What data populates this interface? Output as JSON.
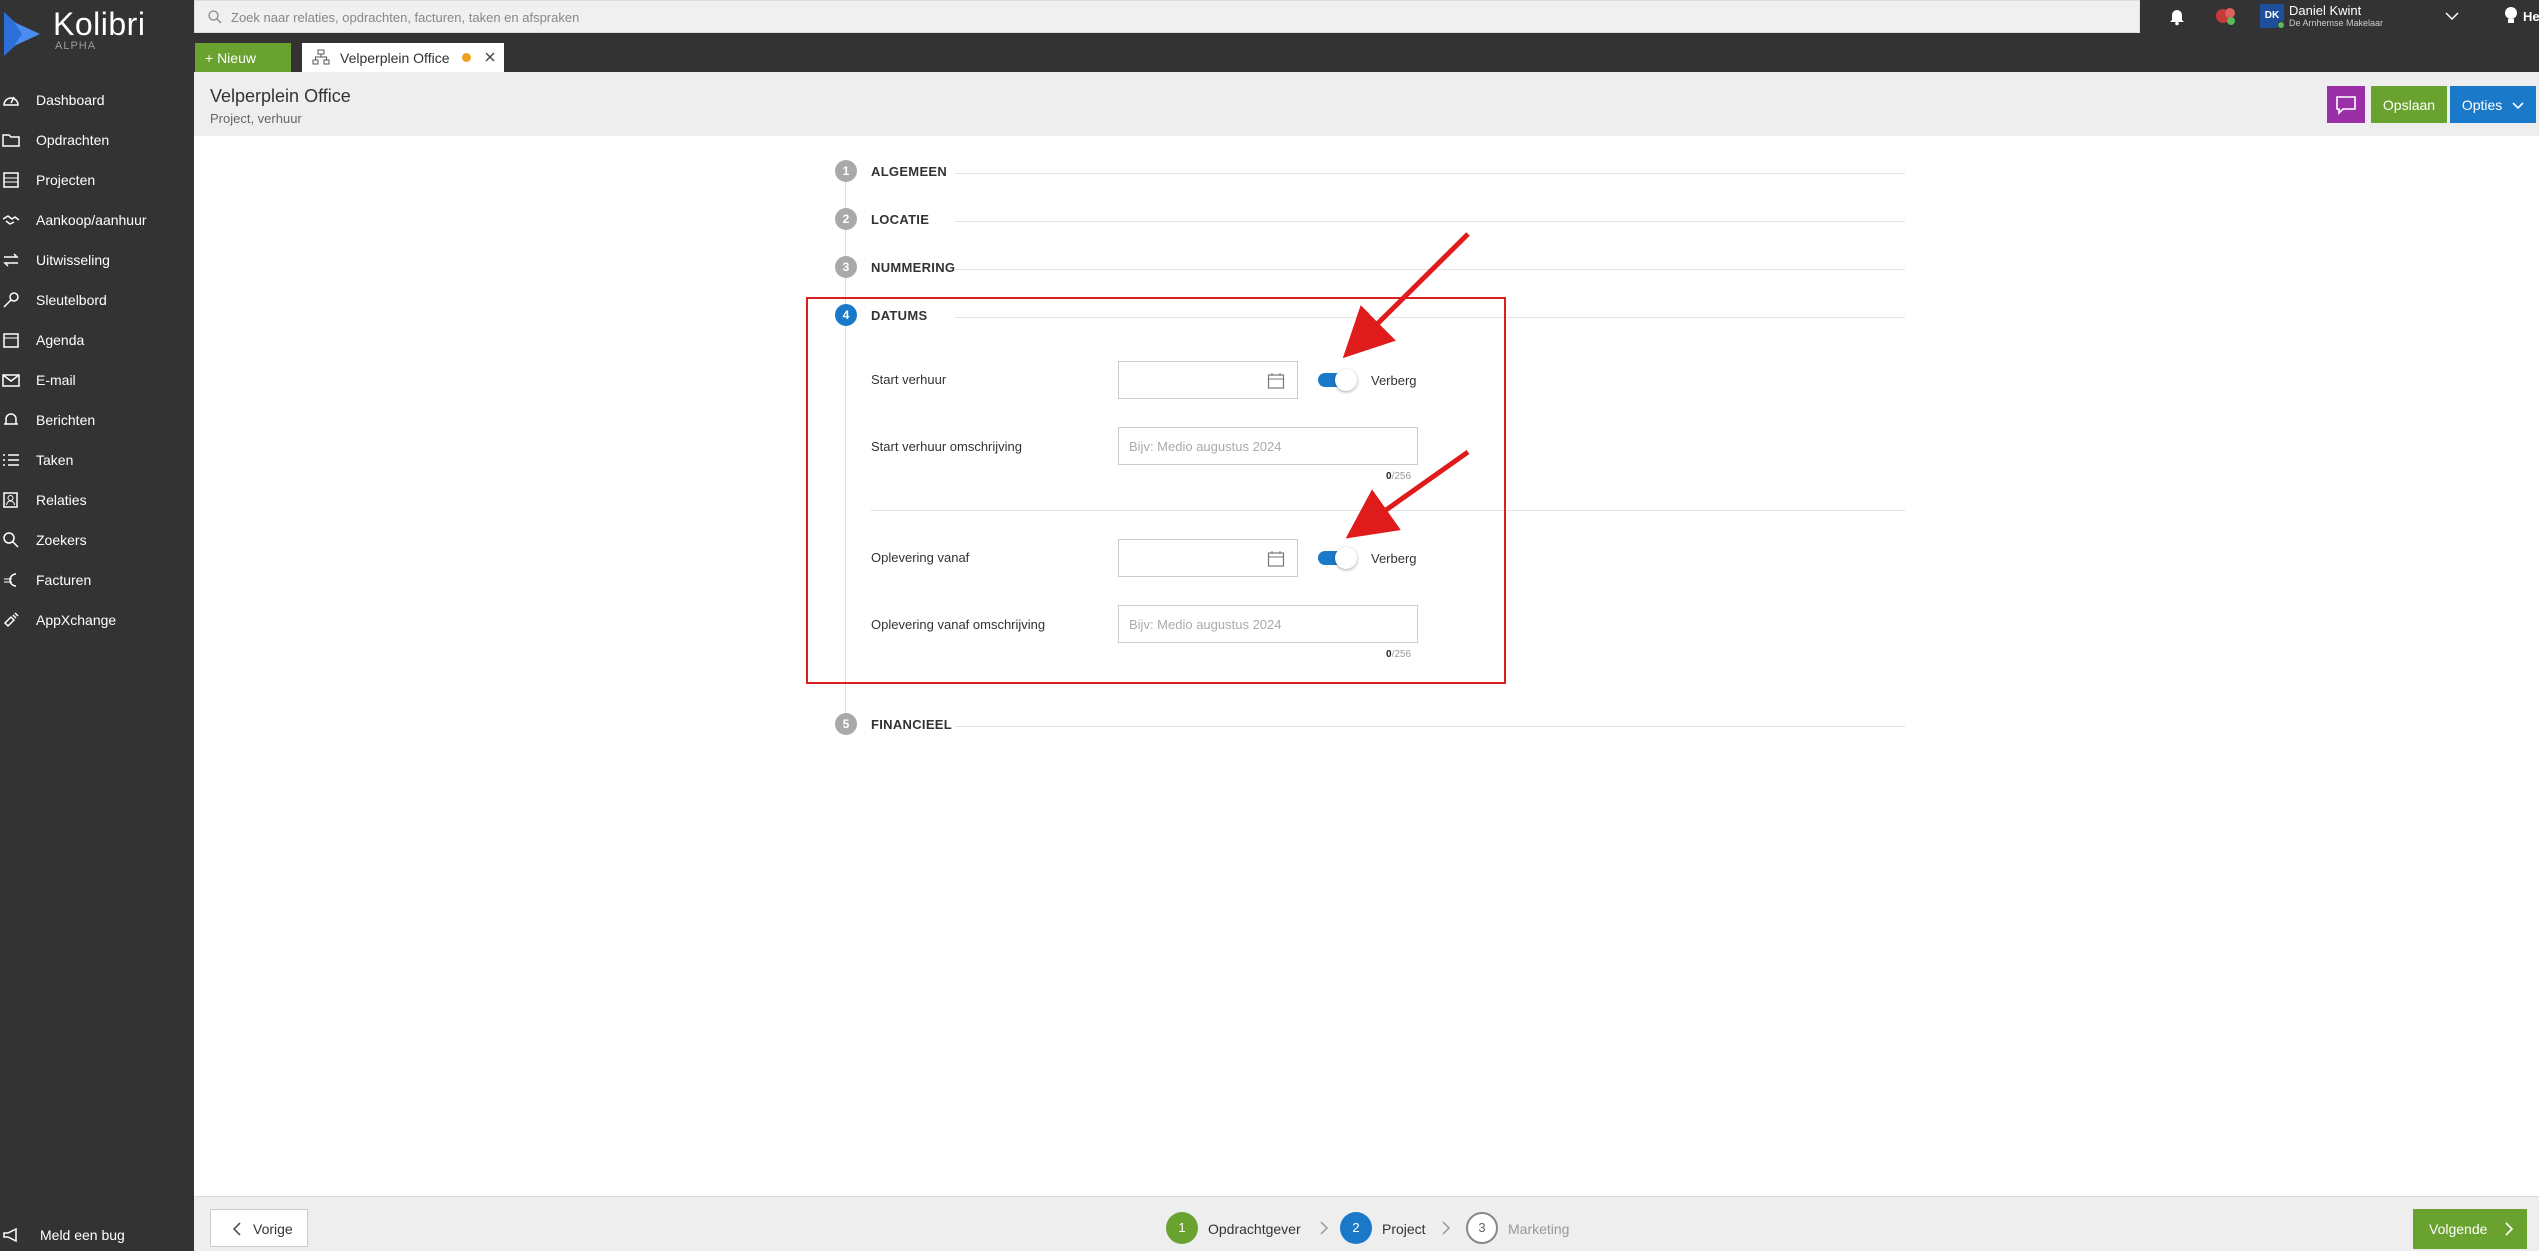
{
  "app": {
    "name": "Kolibri",
    "badge": "ALPHA"
  },
  "search": {
    "placeholder": "Zoek naar relaties, opdrachten, facturen, taken en afspraken"
  },
  "user": {
    "initials": "DK",
    "name": "Daniel Kwint",
    "org": "De Arnhemse Makelaar"
  },
  "help_label": "Help",
  "sidebar": {
    "items": [
      {
        "label": "Dashboard",
        "icon": "gauge-icon"
      },
      {
        "label": "Opdrachten",
        "icon": "folder-icon"
      },
      {
        "label": "Projecten",
        "icon": "building-icon"
      },
      {
        "label": "Aankoop/aanhuur",
        "icon": "handshake-icon"
      },
      {
        "label": "Uitwisseling",
        "icon": "exchange-icon"
      },
      {
        "label": "Sleutelbord",
        "icon": "key-icon"
      },
      {
        "label": "Agenda",
        "icon": "calendar-icon"
      },
      {
        "label": "E-mail",
        "icon": "mail-icon"
      },
      {
        "label": "Berichten",
        "icon": "bell-icon"
      },
      {
        "label": "Taken",
        "icon": "tasks-icon"
      },
      {
        "label": "Relaties",
        "icon": "contact-icon"
      },
      {
        "label": "Zoekers",
        "icon": "search-icon"
      },
      {
        "label": "Facturen",
        "icon": "euro-icon"
      },
      {
        "label": "AppXchange",
        "icon": "plugin-icon"
      }
    ],
    "bug_label": "Meld een bug"
  },
  "tabs": {
    "new_label": "+ Nieuw",
    "open_tab_label": "Velperplein Office"
  },
  "header": {
    "title": "Velperplein Office",
    "subtitle": "Project, verhuur",
    "save_label": "Opslaan",
    "options_label": "Opties"
  },
  "sections": [
    {
      "num": "1",
      "title": "ALGEMEEN"
    },
    {
      "num": "2",
      "title": "LOCATIE"
    },
    {
      "num": "3",
      "title": "NUMMERING"
    },
    {
      "num": "4",
      "title": "DATUMS"
    },
    {
      "num": "5",
      "title": "FINANCIEEL"
    }
  ],
  "datums": {
    "start_label": "Start verhuur",
    "start_hide_label": "Verberg",
    "start_desc_label": "Start verhuur omschrijving",
    "start_desc_placeholder": "Bijv: Medio augustus 2024",
    "start_desc_count": "0",
    "start_desc_max": "/256",
    "oplevering_label": "Oplevering vanaf",
    "oplevering_hide_label": "Verberg",
    "oplevering_desc_label": "Oplevering vanaf omschrijving",
    "oplevering_desc_placeholder": "Bijv: Medio augustus 2024",
    "oplevering_desc_count": "0",
    "oplevering_desc_max": "/256"
  },
  "footer": {
    "prev_label": "Vorige",
    "next_label": "Volgende",
    "steps": [
      {
        "num": "1",
        "label": "Opdrachtgever",
        "state": "done"
      },
      {
        "num": "2",
        "label": "Project",
        "state": "current"
      },
      {
        "num": "3",
        "label": "Marketing",
        "state": "upcoming"
      }
    ]
  },
  "colors": {
    "sidebar_bg": "#333333",
    "green": "#6aa22f",
    "blue": "#1a7ac9",
    "purple": "#9b2fa8",
    "highlight_red": "#d92020"
  }
}
